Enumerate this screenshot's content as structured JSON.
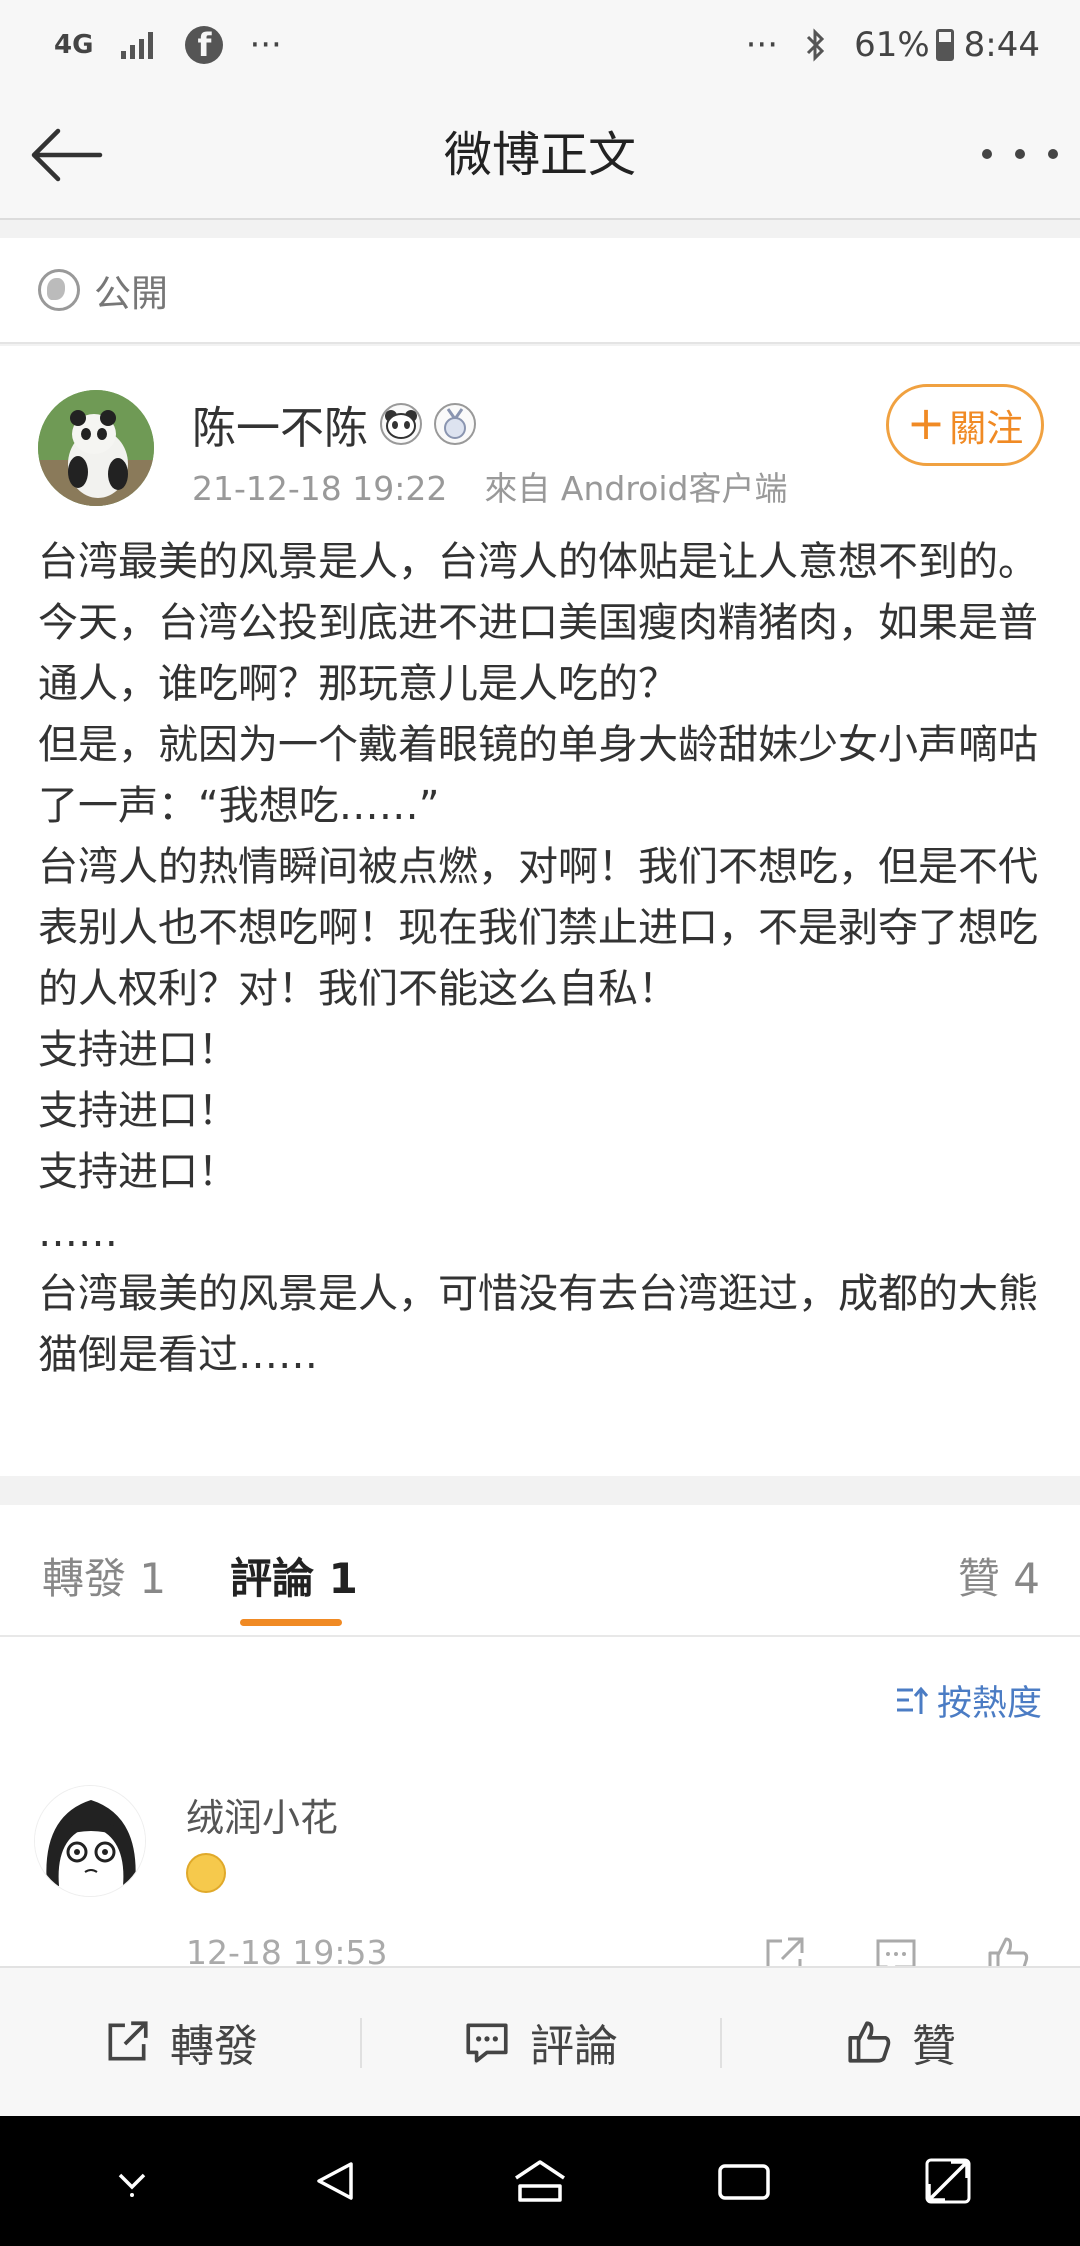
{
  "status_bar": {
    "network": "4G",
    "signal_icon": "signal-icon",
    "app_icon": "facebook-icon",
    "left_more": "···",
    "right_more": "···",
    "bluetooth_icon": "bluetooth-icon",
    "battery": "61%",
    "battery_level": 0.61,
    "time": "8:44"
  },
  "nav": {
    "back_icon": "back-arrow-icon",
    "title": "微博正文",
    "more_icon": "more-icon"
  },
  "visibility": {
    "icon": "globe-icon",
    "label": "公開"
  },
  "post": {
    "author": "陈一不陈",
    "badge_icons": [
      "panda-icon",
      "medal-icon"
    ],
    "time": "21-12-18 19:22",
    "source": "來自 Android客户端",
    "follow_label": "關注",
    "text": "台湾最美的风景是人，台湾人的体贴是让人意想不到的。\n今天，台湾公投到底进不进口美国瘦肉精猪肉，如果是普通人，谁吃啊？那玩意儿是人吃的？\n但是，就因为一个戴着眼镜的单身大龄甜妹少女小声嘀咕了一声：“我想吃……”\n台湾人的热情瞬间被点燃，对啊！我们不想吃，但是不代表别人也不想吃啊！现在我们禁止进口，不是剥夺了想吃的人权利？对！我们不能这么自私！\n支持进口！\n支持进口！\n支持进口！\n……\n台湾最美的风景是人，可惜没有去台湾逛过，成都的大熊猫倒是看过……"
  },
  "tabs": {
    "repost": "轉發 1",
    "comments": "評論 1",
    "likes": "贊 4"
  },
  "comments": {
    "sort_label": "按熱度",
    "items": [
      {
        "name": "绒润小花",
        "emoji": "sweat-emoji",
        "time": "12-18 19:53"
      }
    ]
  },
  "actions": {
    "repost": "轉發",
    "comment": "評論",
    "like": "贊"
  },
  "colors": {
    "accent": "#f08a24",
    "link": "#4b7cc4"
  }
}
